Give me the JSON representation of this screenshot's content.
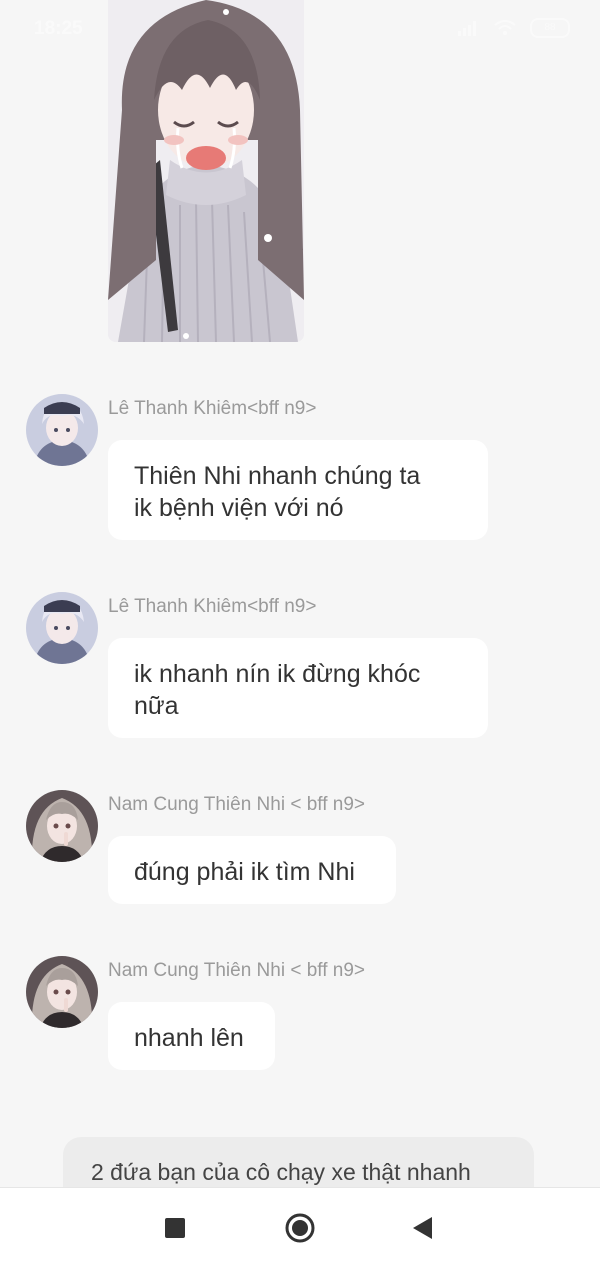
{
  "status_bar": {
    "time": "18:25",
    "battery": "88"
  },
  "messages": [
    {
      "sender": "Lê Thanh Khiêm<bff n9>",
      "avatar": "boy-avatar",
      "text_lines": [
        "Thiên Nhi nhanh chúng ta",
        "ik bệnh viện với nó"
      ]
    },
    {
      "sender": "Lê Thanh Khiêm<bff n9>",
      "avatar": "boy-avatar",
      "text_lines": [
        "ik nhanh nín ik đừng khóc",
        "nữa"
      ]
    },
    {
      "sender": "Nam Cung Thiên Nhi < bff n9>",
      "avatar": "girl-avatar",
      "text_lines": [
        "đúng phải ik tìm Nhi"
      ]
    },
    {
      "sender": "Nam Cung Thiên Nhi < bff n9>",
      "avatar": "girl-avatar",
      "text_lines": [
        "nhanh lên"
      ]
    }
  ],
  "narration": "2 đứa bạn của cô chạy xe thật nhanh",
  "nav": {
    "icons": [
      "square-recents-icon",
      "circle-home-icon",
      "triangle-back-icon"
    ]
  },
  "colors": {
    "background": "#f6f6f6",
    "bubble": "#ffffff",
    "sender_name": "#9a9a9a",
    "narration_bg": "#ececec"
  }
}
